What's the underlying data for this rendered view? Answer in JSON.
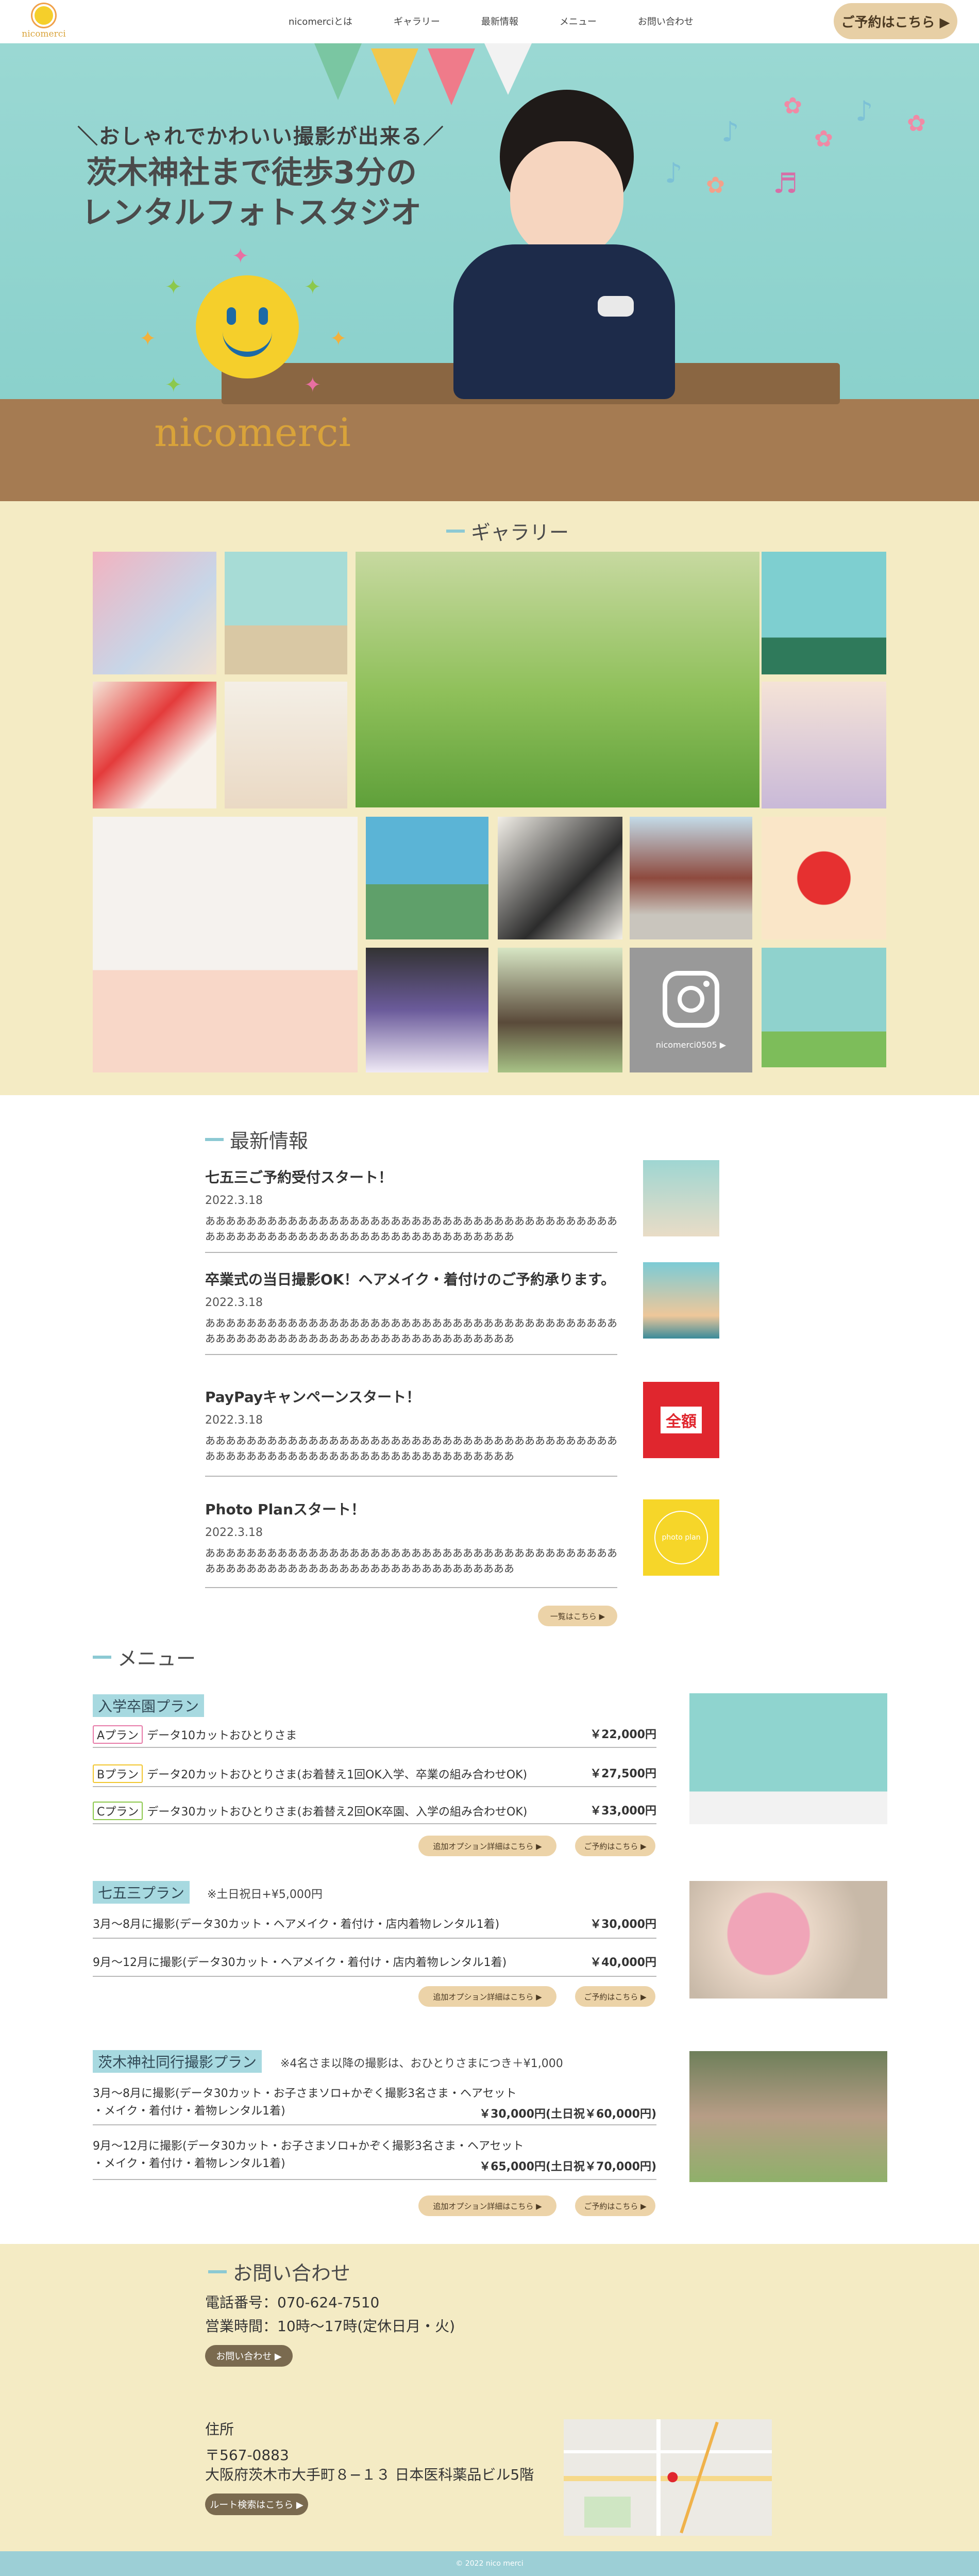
{
  "header": {
    "logo_text": "nicomerci",
    "nav": [
      "nicomerciとは",
      "ギャラリー",
      "最新情報",
      "メニュー",
      "お問い合わせ"
    ],
    "reserve": "ご予約はこちら ▶"
  },
  "hero": {
    "tagline": "＼おしゃれでかわいい撮影が出来る／",
    "headline_1": "茨木神社まで徒歩3分の",
    "headline_2": "レンタルフォトスタジオ",
    "logo_text": "nicomerci"
  },
  "gallery": {
    "title": "ギャラリー",
    "instagram_label": "nicomerci0505 ▶"
  },
  "news": {
    "title": "最新情報",
    "items": [
      {
        "title": "七五三ご予約受付スタート！",
        "date": "2022.3.18",
        "body": "ああああああああああああああああああああああああああああああああああああああああああああああああああああああああああああああああああああああ"
      },
      {
        "title": "卒業式の当日撮影OK！ヘアメイク・着付けのご予約承ります。",
        "date": "2022.3.18",
        "body": "ああああああああああああああああああああああああああああああああああああああああああああああああああああああああああああああああああああああ"
      },
      {
        "title": "PayPayキャンペーンスタート！",
        "date": "2022.3.18",
        "body": "ああああああああああああああああああああああああああああああああああああああああああああああああああああああああああああああああああああああ"
      },
      {
        "title": "Photo Planスタート！",
        "date": "2022.3.18",
        "body": "ああああああああああああああああああああああああああああああああああああああああああああああああああああああああああああああああああああああ"
      }
    ],
    "more": "一覧はこちら ▶",
    "thumb_paypay": "全額",
    "thumb_photo": "photo plan"
  },
  "menu": {
    "title": "メニュー",
    "option_btn": "追加オプション詳細はこちら ▶",
    "reserve_btn": "ご予約はこちら ▶",
    "plan1": {
      "name": "入学卒園プラン",
      "rows": [
        {
          "badge": "Aプラン",
          "label": "データ10カットおひとりさま",
          "price": "￥22,000円"
        },
        {
          "badge": "Bプラン",
          "label": "データ20カットおひとりさま(お着替え1回OK入学、卒業の組み合わせOK)",
          "price": "￥27,500円"
        },
        {
          "badge": "Cプラン",
          "label": "データ30カットおひとりさま(お着替え2回OK卒園、入学の組み合わせOK)",
          "price": "￥33,000円"
        }
      ]
    },
    "plan2": {
      "name": "七五三プラン",
      "note": "※土日祝日+¥5,000円",
      "rows": [
        {
          "label": "3月〜8月に撮影(データ30カット・ヘアメイク・着付け・店内着物レンタル1着)",
          "price": "￥30,000円"
        },
        {
          "label": "9月〜12月に撮影(データ30カット・ヘアメイク・着付け・店内着物レンタル1着)",
          "price": "￥40,000円"
        }
      ]
    },
    "plan3": {
      "name": "茨木神社同行撮影プラン",
      "note": "※4名さま以降の撮影は、おひとりさまにつき＋¥1,000",
      "rows": [
        {
          "label1": "3月〜8月に撮影(データ30カット・お子さまソロ+かぞく撮影3名さま・ヘアセット",
          "label2": "・メイク・着付け・着物レンタル1着)",
          "price": "￥30,000円(土日祝￥60,000円)"
        },
        {
          "label1": "9月〜12月に撮影(データ30カット・お子さまソロ+かぞく撮影3名さま・ヘアセット",
          "label2": "・メイク・着付け・着物レンタル1着)",
          "price": "￥65,000円(土日祝￥70,000円)"
        }
      ]
    }
  },
  "contact": {
    "title": "お問い合わせ",
    "phone": "電話番号：070-624-7510",
    "hours": "営業時間：10時〜17時(定休日月・火)",
    "contact_btn": "お問い合わせ ▶",
    "address_label": "住所",
    "postal": "〒567-0883",
    "address": "大阪府茨木市大手町８−１３ 日本医科薬品ビル5階",
    "route_btn": "ルート検索はこちら ▶"
  },
  "footer": {
    "copyright": "© 2022 nico merci"
  },
  "colors": {
    "accent_blue": "#8cc9d3",
    "cream": "#f4ebc4",
    "button_tan": "#ecd3a8",
    "logo_gold": "#d9a33a"
  }
}
